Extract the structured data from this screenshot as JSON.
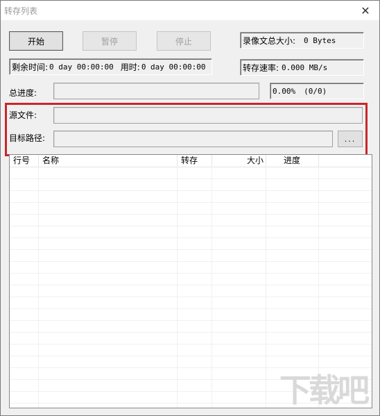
{
  "window": {
    "title": "转存列表",
    "close_glyph": "✕"
  },
  "toolbar": {
    "start_label": "开始",
    "pause_label": "暂停",
    "stop_label": "停止"
  },
  "status": {
    "total_size_label": "录像文总大小:",
    "total_size_value": "0 Bytes",
    "remaining_label": "剩余时间:",
    "remaining_value": "0 day 00:00:00",
    "elapsed_label": "用时:",
    "elapsed_value": "0 day 00:00:00",
    "speed_label": "转存速率:",
    "speed_value": "0.000 MB/s"
  },
  "progress": {
    "label": "总进度:",
    "percent_text": "0.00%",
    "count_text": "(0/0)",
    "fraction": 0.0
  },
  "paths": {
    "source_label": "源文件:",
    "target_label": "目标路径:",
    "source_value": "",
    "target_value": "",
    "browse_label": "..."
  },
  "table": {
    "columns": [
      {
        "label": "行号"
      },
      {
        "label": "名称"
      },
      {
        "label": "转存"
      },
      {
        "label": "大小"
      },
      {
        "label": "进度"
      }
    ],
    "rows": []
  },
  "watermark": {
    "text": "下载吧"
  },
  "colors": {
    "highlight": "#c9262a",
    "window_bg": "#f0f0f0"
  }
}
